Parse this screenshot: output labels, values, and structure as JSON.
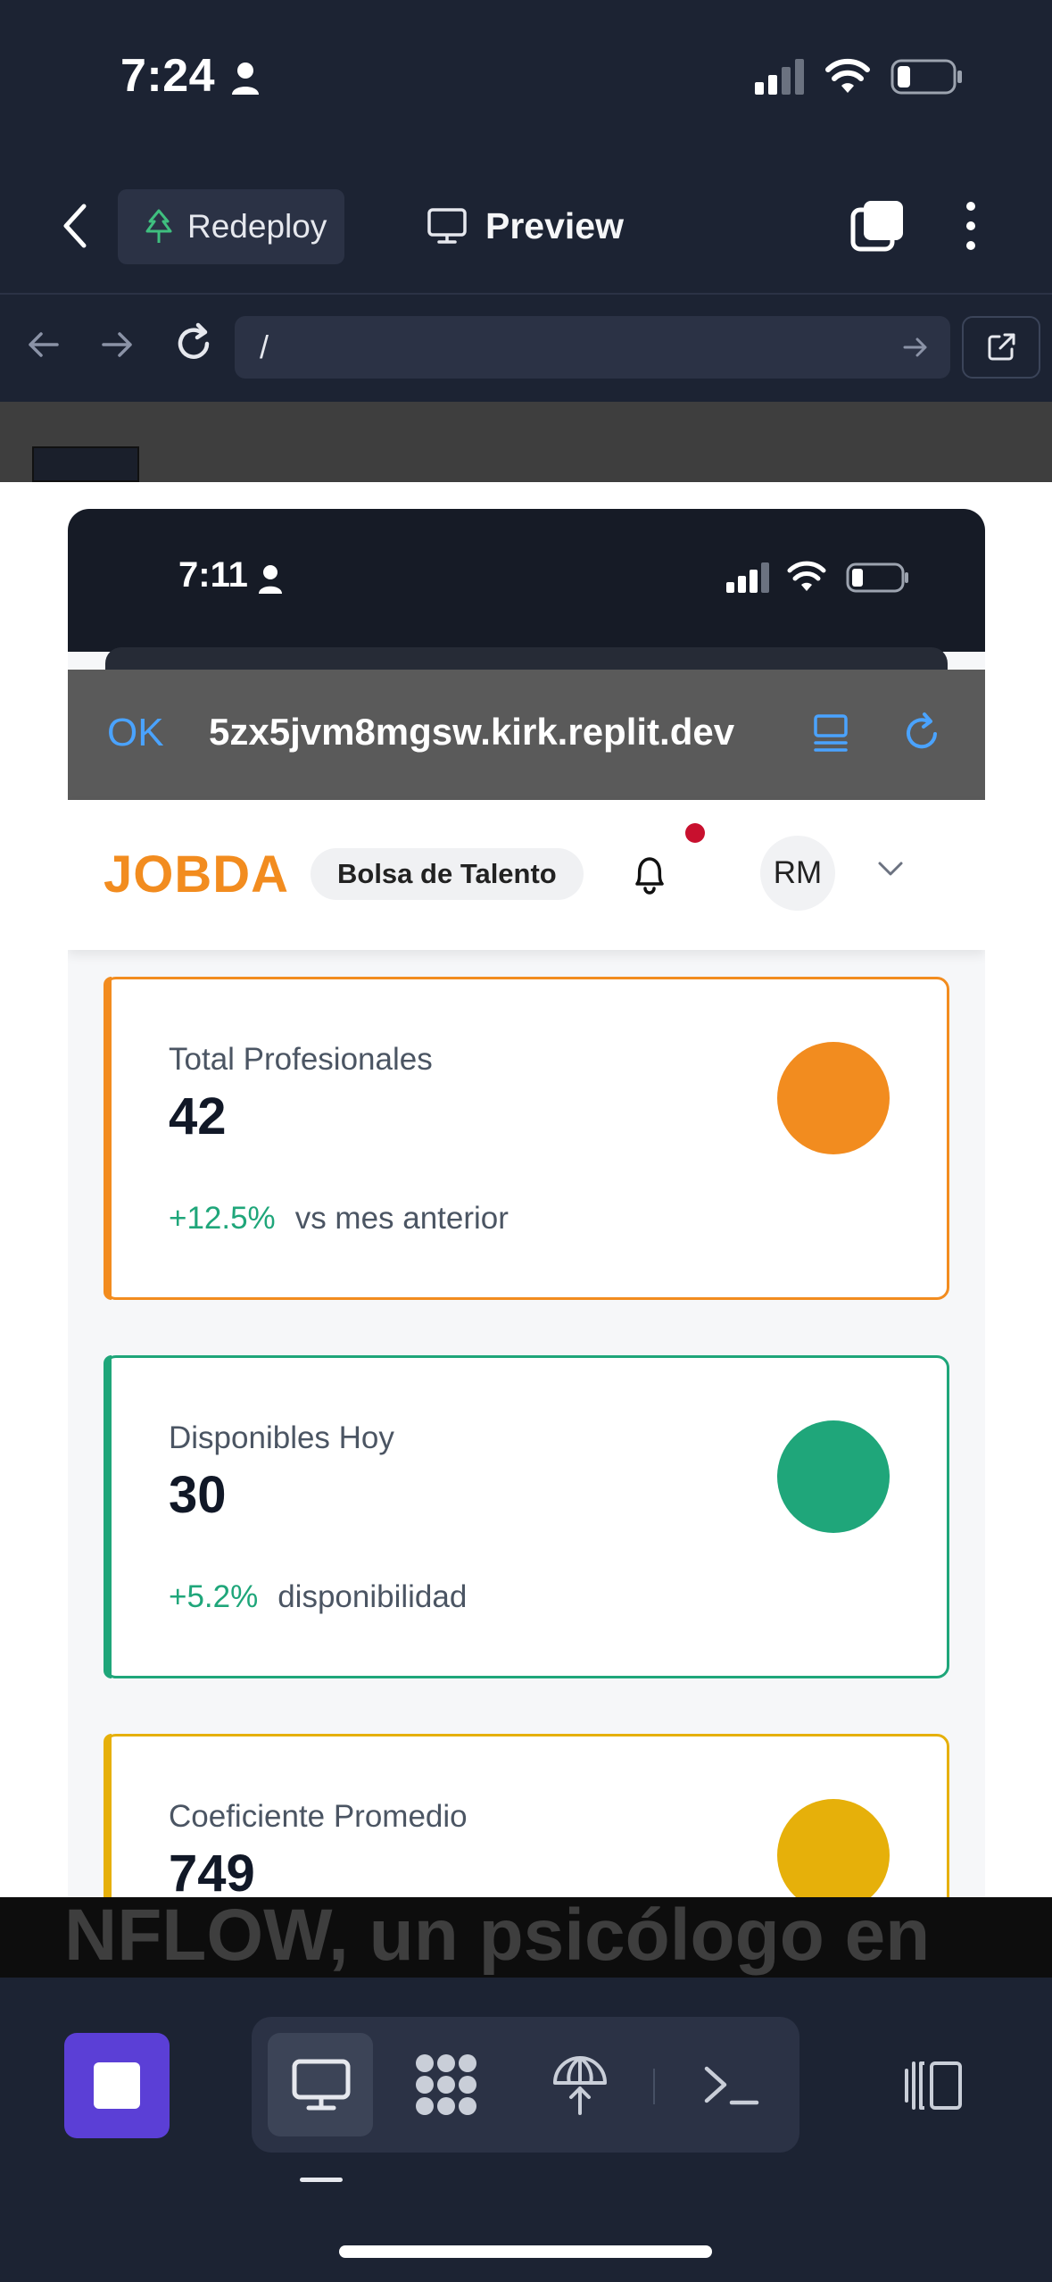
{
  "status_bar": {
    "time": "7:24"
  },
  "top_bar": {
    "redeploy_label": "Redeploy",
    "preview_label": "Preview"
  },
  "url_bar": {
    "value": "/"
  },
  "preview": {
    "inner_status": {
      "time": "7:11"
    },
    "safari": {
      "ok_label": "OK",
      "url": "5zx5jvm8mgsw.kirk.replit.dev"
    },
    "header": {
      "logo": "JOBDA",
      "chip": "Bolsa de Talento",
      "avatar_initials": "RM",
      "notification_color": "#c8102e"
    },
    "stats": [
      {
        "label": "Total Profesionales",
        "value": "42",
        "delta": "+12.5%",
        "note": "vs mes anterior",
        "color": "#f28c1f"
      },
      {
        "label": "Disponibles Hoy",
        "value": "30",
        "delta": "+5.2%",
        "note": "disponibilidad",
        "color": "#1fa67a"
      },
      {
        "label": "Coeficiente Promedio",
        "value": "749",
        "delta": "",
        "note": "",
        "color": "#e6b00a"
      }
    ]
  },
  "background_headline": "NFLOW, un psicólogo en",
  "colors": {
    "app_bg": "#1c2333",
    "stop_button": "#5b3fd6",
    "brand_orange": "#f28c1f",
    "safari_link": "#4aa3ff"
  },
  "icons": {
    "top_bar": [
      "back-icon",
      "tree-icon",
      "monitor-icon",
      "tabs-icon",
      "more-vertical-icon"
    ],
    "url_bar": [
      "arrow-left-icon",
      "arrow-right-icon",
      "reload-icon",
      "arrow-right-icon",
      "external-link-icon"
    ],
    "bottom_bar": [
      "stop-icon",
      "monitor-icon",
      "dots-grid-icon",
      "deploy-globe-icon",
      "terminal-icon",
      "panel-toggle-icon"
    ]
  }
}
